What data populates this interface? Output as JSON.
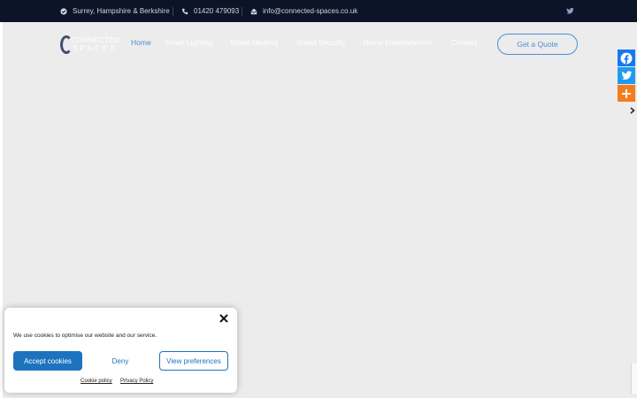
{
  "topbar": {
    "location": "Surrey, Hampshire & Berkshire",
    "phone": "01420 479093",
    "email": "info@connected-spaces.co.uk",
    "icons": {
      "location": "check-circle-icon",
      "phone": "phone-icon",
      "email": "envelope-icon",
      "social": "twitter-icon"
    }
  },
  "header": {
    "logo": {
      "line1": "CONNECTED",
      "line2": "SPACES"
    },
    "nav": [
      {
        "label": "Home",
        "active": true
      },
      {
        "label": "Smart Lighting"
      },
      {
        "label": "Smart Heating"
      },
      {
        "label": "Smart Security"
      },
      {
        "label": "Home Entertainment"
      },
      {
        "label": "Contact"
      }
    ],
    "cta": "Get a Quote"
  },
  "share_bar": {
    "items": [
      "facebook-icon",
      "twitter-icon",
      "more-plus-icon"
    ],
    "colors": {
      "facebook": "#1877f2",
      "twitter": "#1d9bf0",
      "more": "#f47c20"
    }
  },
  "cookie_banner": {
    "message": "We use cookies to optimise our website and our service.",
    "accept": "Accept cookies",
    "deny": "Deny",
    "preferences": "View preferences",
    "links": [
      "Cookie policy",
      "Privacy Policy"
    ]
  },
  "colors": {
    "topbar": "#0c1428",
    "accent": "#4a8fd6",
    "cookie_primary": "#1e73be",
    "page_bg": "#ececec"
  }
}
